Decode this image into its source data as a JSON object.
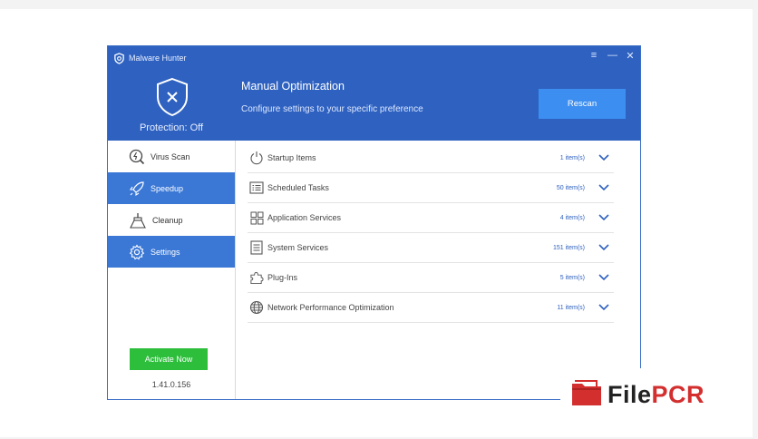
{
  "app": {
    "title": "Malware Hunter",
    "window_controls": [
      "menu-icon",
      "minimize-icon",
      "close-icon"
    ]
  },
  "header": {
    "protection_status": "Protection: Off",
    "section_title": "Manual Optimization",
    "section_subtitle": "Configure settings to your specific preference",
    "rescan_label": "Rescan"
  },
  "sidebar": {
    "items": [
      {
        "label": "Virus Scan",
        "icon": "virus-scan-icon",
        "active": false
      },
      {
        "label": "Speedup",
        "icon": "rocket-icon",
        "active": true
      },
      {
        "label": "Cleanup",
        "icon": "broom-icon",
        "active": false
      },
      {
        "label": "Settings",
        "icon": "gear-icon",
        "active": true
      }
    ],
    "activate_label": "Activate Now",
    "version": "1.41.0.156"
  },
  "optimization_items": [
    {
      "label": "Startup Items",
      "count": "1 item(s)",
      "icon": "power-icon"
    },
    {
      "label": "Scheduled Tasks",
      "count": "50 item(s)",
      "icon": "task-list-icon"
    },
    {
      "label": "Application Services",
      "count": "4 item(s)",
      "icon": "grid-icon"
    },
    {
      "label": "System Services",
      "count": "151 item(s)",
      "icon": "document-icon"
    },
    {
      "label": "Plug-Ins",
      "count": "5 item(s)",
      "icon": "puzzle-icon"
    },
    {
      "label": "Network Performance Optimization",
      "count": "11 item(s)",
      "icon": "globe-icon"
    }
  ],
  "watermark": {
    "text_prefix": "File",
    "text_suffix": "PCR"
  },
  "colors": {
    "header_blue": "#2f62c0",
    "active_blue": "#3b78d6",
    "rescan_blue": "#3c8ef0",
    "activate_green": "#2dbe3c",
    "count_blue": "#2f62c0"
  }
}
